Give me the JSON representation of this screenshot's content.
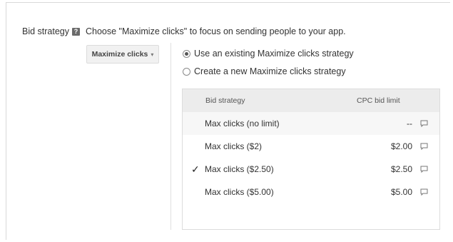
{
  "bid_strategy": {
    "label": "Bid strategy",
    "help_icon": "help-icon",
    "description": "Choose \"Maximize clicks\" to focus on sending people to your app."
  },
  "dropdown": {
    "selected": "Maximize clicks",
    "caret": "▾"
  },
  "radios": [
    {
      "label": "Use an existing Maximize clicks strategy",
      "checked": true
    },
    {
      "label": "Create a new Maximize clicks strategy",
      "checked": false
    }
  ],
  "table": {
    "headers": {
      "strategy": "Bid strategy",
      "limit": "CPC bid limit"
    },
    "rows": [
      {
        "name": "Max clicks (no limit)",
        "limit": "--",
        "check": ""
      },
      {
        "name": "Max clicks ($2)",
        "limit": "$2.00",
        "check": ""
      },
      {
        "name": "Max clicks ($2.50)",
        "limit": "$2.50",
        "check": "✓"
      },
      {
        "name": "Max clicks ($5.00)",
        "limit": "$5.00",
        "check": ""
      }
    ]
  },
  "icons": {
    "row_action": "comment-icon",
    "selected_row": "checkmark-icon"
  }
}
